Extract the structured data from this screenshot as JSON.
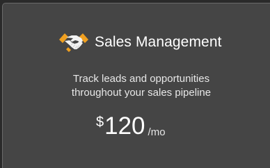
{
  "plan": {
    "icon": "handshake-icon",
    "title": "Sales Management",
    "description_line1": "Track leads and opportunities",
    "description_line2": "throughout your sales pipeline",
    "currency": "$",
    "amount": "120",
    "period": "/mo"
  },
  "colors": {
    "background": "#2a2a2a",
    "card": "#454545",
    "card_border": "#6a6a6a",
    "icon_orange": "#f0a020",
    "text": "#ffffff"
  }
}
